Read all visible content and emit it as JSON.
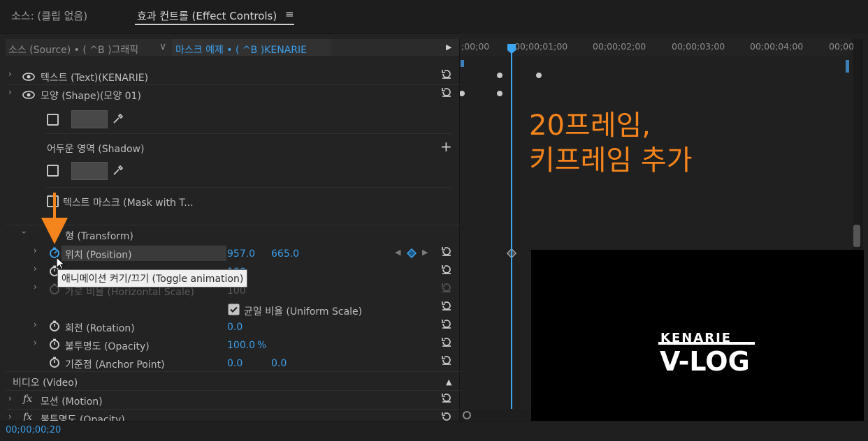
{
  "tabs": {
    "source": "소스: (클립 없음)",
    "effect_controls": "효과 컨트롤 (Effect Controls)",
    "menu_icon": "≡"
  },
  "header": {
    "source_label": "소스 (Source) • ( ^B )그래픽",
    "chevron": "∨",
    "clip_label": "마스크 예제 • ( ^B )KENARIE",
    "play_icon": "▶"
  },
  "timeline": {
    "ticks": [
      ";00;00",
      "00;00;01;00",
      "00;00;02;00",
      "00;00;03;00",
      "00;00;04;00",
      "00;00"
    ]
  },
  "rows": {
    "text_layer": "텍스트 (Text)(KENARIE)",
    "shape_layer": "모양 (Shape)(모양 01)",
    "shadow": "어두운 영역 (Shadow)",
    "shadow_add": "+",
    "mask_with_text": "텍스트 마스크 (Mask with T...",
    "transform": "형 (Transform)",
    "position_label": "위치 (Position)",
    "position_x": "957.0",
    "position_y": "665.0",
    "scale_value": "100",
    "horizontal_scale": "가로 비율 (Horizontal Scale)",
    "horizontal_scale_value": "100",
    "uniform_scale": "균일 비율 (Uniform Scale)",
    "rotation": "회전 (Rotation)",
    "rotation_value": "0.0",
    "opacity": "불투명도 (Opacity)",
    "opacity_value": "100.0",
    "opacity_unit": "%",
    "anchor": "기준점 (Anchor Point)",
    "anchor_x": "0.0",
    "anchor_y": "0.0",
    "video_section": "비디오 (Video)",
    "motion": "모션 (Motion)",
    "video_opacity": "불투명도 (Opacity)"
  },
  "tooltip": "애니메이션 켜기/끄기 (Toggle animation)",
  "overlay": {
    "line1": "20프레임,",
    "line2": "키프레임 추가"
  },
  "preview": {
    "logo_top": "KENARIE",
    "logo_main": "V-LOG"
  },
  "timecode": "00;00;00;20",
  "colors": {
    "accent_blue": "#3d9ee8",
    "annotation_orange": "#f4841c",
    "panel_bg": "#232323"
  }
}
